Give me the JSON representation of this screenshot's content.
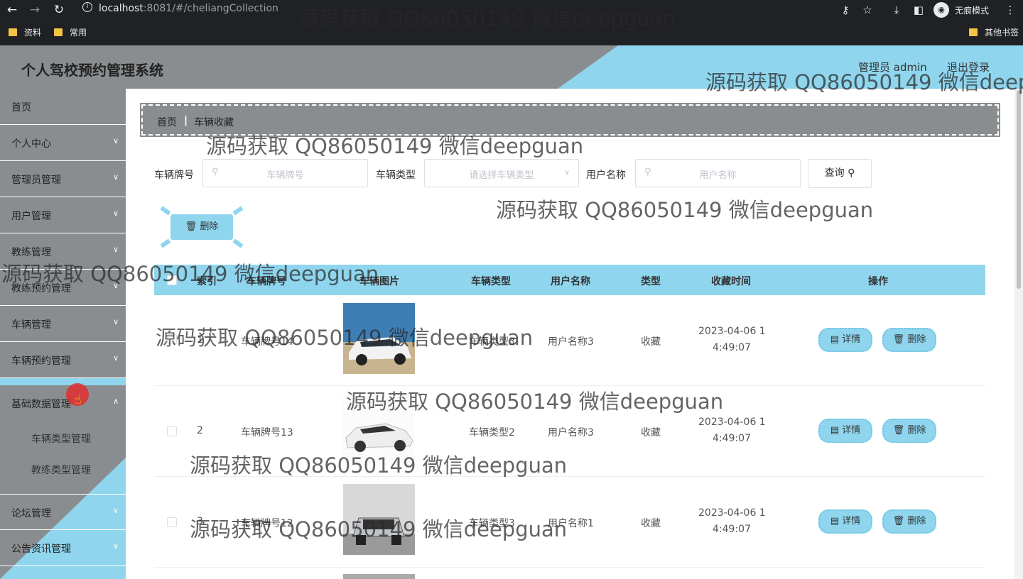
{
  "browser": {
    "url_host": "localhost",
    "url_path": ":8081/#/cheliangCollection",
    "incognito_label": "无痕模式",
    "bookmarks": [
      "资料",
      "常用"
    ],
    "other_bookmarks": "其他书签"
  },
  "header": {
    "title": "个人驾校预约管理系统",
    "user": "管理员 admin",
    "logout": "退出登录"
  },
  "sidebar": {
    "items": [
      "首页",
      "个人中心",
      "管理员管理",
      "用户管理",
      "教练管理",
      "教练预约管理",
      "车辆管理",
      "车辆预约管理",
      "基础数据管理",
      "论坛管理",
      "公告资讯管理"
    ],
    "sub_items": [
      "车辆类型管理",
      "教练类型管理"
    ]
  },
  "breadcrumb": {
    "home": "首页",
    "separator": "|",
    "current": "车辆收藏"
  },
  "filters": {
    "plate_label": "车辆牌号",
    "plate_placeholder": "车辆牌号",
    "type_label": "车辆类型",
    "type_placeholder": "请选择车辆类型",
    "user_label": "用户名称",
    "user_placeholder": "用户名称",
    "query_button": "查询"
  },
  "actions": {
    "delete_button": "删除"
  },
  "table": {
    "headers": [
      "索引",
      "车辆牌号",
      "车辆图片",
      "车辆类型",
      "用户名称",
      "类型",
      "收藏时间",
      "操作"
    ],
    "rows": [
      {
        "index": "1",
        "plate": "车辆牌号14",
        "type": "车辆类型3",
        "user": "用户名称3",
        "kind": "收藏",
        "time1": "2023-04-06 1",
        "time2": "4:49:07"
      },
      {
        "index": "2",
        "plate": "车辆牌号13",
        "type": "车辆类型2",
        "user": "用户名称3",
        "kind": "收藏",
        "time1": "2023-04-06 1",
        "time2": "4:49:07"
      },
      {
        "index": "3",
        "plate": "车辆牌号12",
        "type": "车辆类型3",
        "user": "用户名称1",
        "kind": "收藏",
        "time1": "2023-04-06 1",
        "time2": "4:49:07"
      }
    ],
    "detail_button": "详情",
    "row_delete_button": "删除"
  },
  "watermark": "源码获取 QQ86050149 微信deepguan",
  "colors": {
    "accent": "#8fd5ee",
    "gray": "#8a8d90",
    "chrome": "#202124"
  }
}
